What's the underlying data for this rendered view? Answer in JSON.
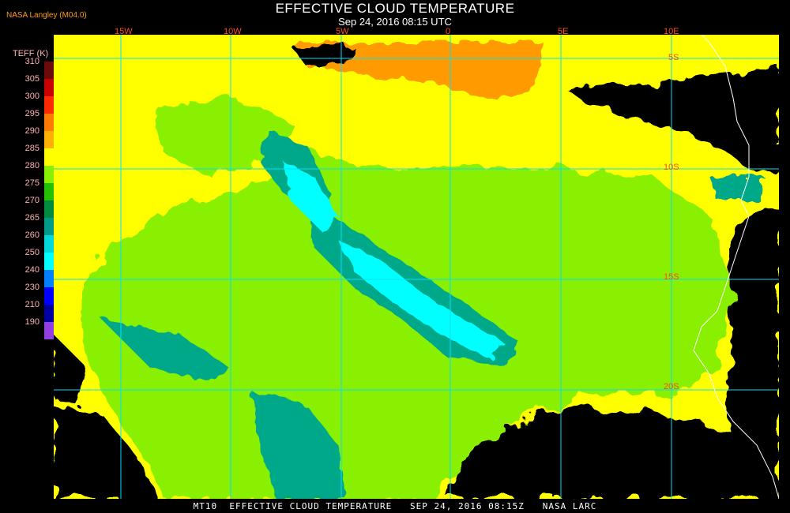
{
  "header": {
    "title": "EFFECTIVE CLOUD TEMPERATURE",
    "subtitle": "Sep 24, 2016 08:15 UTC",
    "credit": "NASA Langley (M04.0)"
  },
  "legend": {
    "title": "TEFF (K)",
    "entries": [
      {
        "label": "310",
        "color": "#6a0a0a"
      },
      {
        "label": "305",
        "color": "#c80000"
      },
      {
        "label": "300",
        "color": "#ff2a00"
      },
      {
        "label": "295",
        "color": "#ff7a00"
      },
      {
        "label": "290",
        "color": "#ffb000"
      },
      {
        "label": "285",
        "color": "#ffff00"
      },
      {
        "label": "280",
        "color": "#88f000"
      },
      {
        "label": "275",
        "color": "#22c000"
      },
      {
        "label": "270",
        "color": "#008a40"
      },
      {
        "label": "265",
        "color": "#009a8a"
      },
      {
        "label": "260",
        "color": "#00d8d8"
      },
      {
        "label": "250",
        "color": "#00ffff"
      },
      {
        "label": "240",
        "color": "#0080ff"
      },
      {
        "label": "230",
        "color": "#0000ff"
      },
      {
        "label": "210",
        "color": "#0000a0"
      },
      {
        "label": "190",
        "color": "#9040e0"
      }
    ]
  },
  "grid": {
    "lon_labels": [
      "15W",
      "10W",
      "5W",
      "0",
      "5E",
      "10E"
    ],
    "lat_labels": [
      "5S",
      "10S",
      "15S",
      "20S"
    ]
  },
  "footer": {
    "text": "MT10  EFFECTIVE CLOUD TEMPERATURE   SEP 24, 2016 08:15Z   NASA LARC"
  },
  "colors": {
    "grid_line": "#00e0ff",
    "coastline": "#ffffff",
    "label": "#ff4a1a"
  }
}
